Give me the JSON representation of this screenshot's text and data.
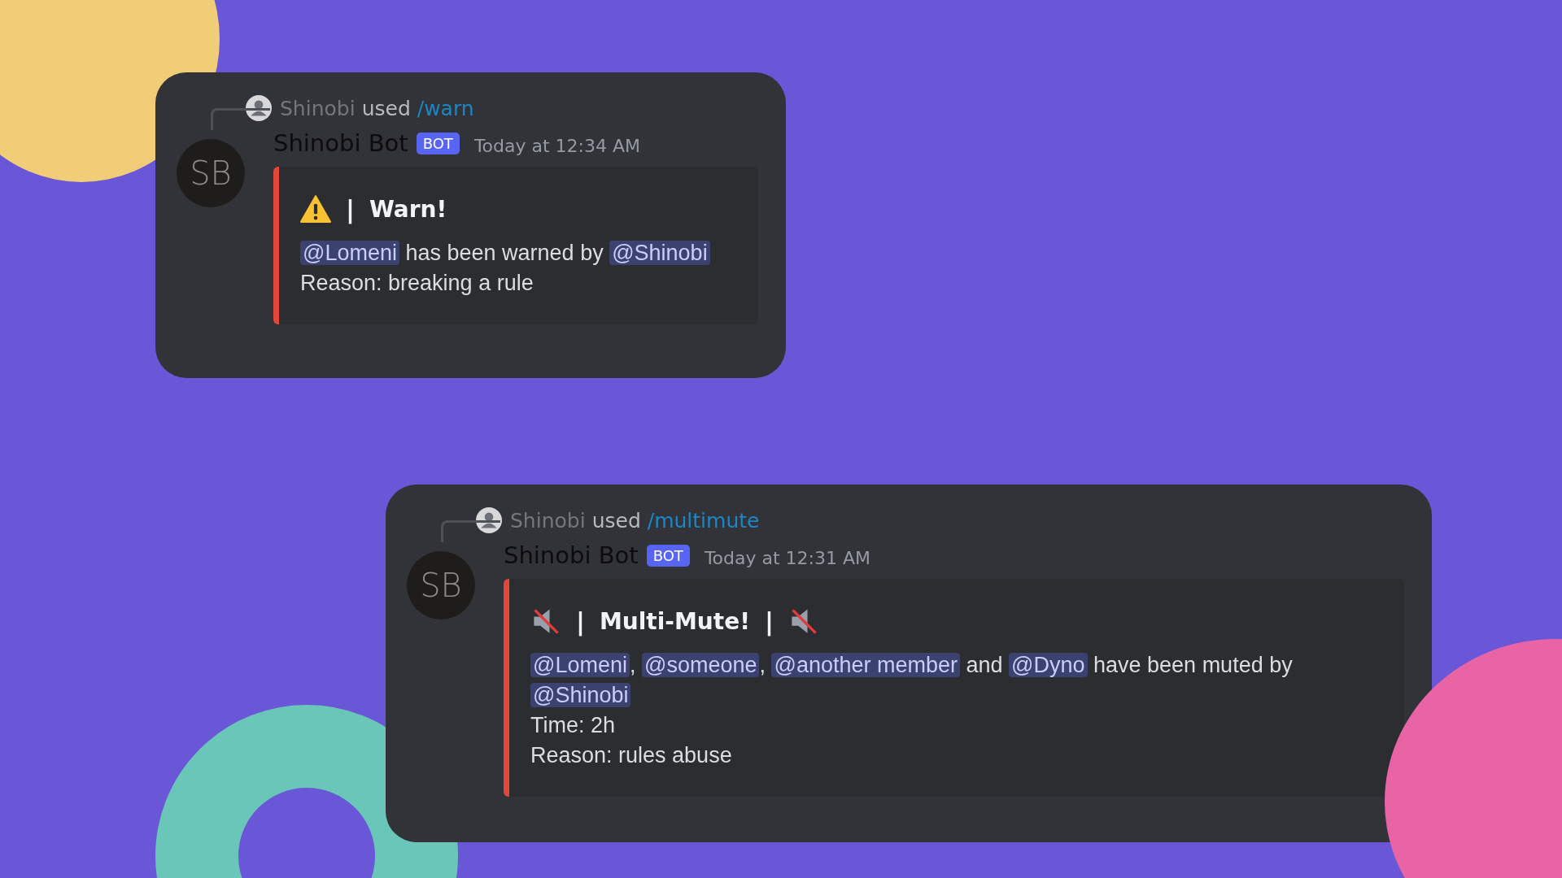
{
  "messages": [
    {
      "reply": {
        "user": "Shinobi",
        "verb": "used",
        "command": "/warn"
      },
      "avatar_text": "SB",
      "author": "Shinobi Bot",
      "badge": "BOT",
      "timestamp": "Today at 12:34 AM",
      "embed": {
        "title_parts": [
          {
            "kind": "warning"
          },
          {
            "kind": "text",
            "text": "|"
          },
          {
            "kind": "text",
            "text": "Warn!"
          }
        ],
        "lines": [
          [
            {
              "kind": "mention",
              "text": "@Lomeni"
            },
            {
              "kind": "text",
              "text": " has been warned by "
            },
            {
              "kind": "mention",
              "text": "@Shinobi"
            }
          ],
          [
            {
              "kind": "text",
              "text": "Reason: breaking a rule"
            }
          ]
        ]
      }
    },
    {
      "reply": {
        "user": "Shinobi",
        "verb": "used",
        "command": "/multimute"
      },
      "avatar_text": "SB",
      "author": "Shinobi Bot",
      "badge": "BOT",
      "timestamp": "Today at 12:31 AM",
      "embed": {
        "title_parts": [
          {
            "kind": "mute"
          },
          {
            "kind": "text",
            "text": "|"
          },
          {
            "kind": "text",
            "text": "Multi-Mute!"
          },
          {
            "kind": "text",
            "text": "|"
          },
          {
            "kind": "mute"
          }
        ],
        "lines": [
          [
            {
              "kind": "mention",
              "text": "@Lomeni"
            },
            {
              "kind": "text",
              "text": ", "
            },
            {
              "kind": "mention",
              "text": "@someone"
            },
            {
              "kind": "text",
              "text": ", "
            },
            {
              "kind": "mention",
              "text": "@another member"
            },
            {
              "kind": "text",
              "text": " and "
            },
            {
              "kind": "mention",
              "text": "@Dyno"
            },
            {
              "kind": "text",
              "text": " have been muted by"
            }
          ],
          [
            {
              "kind": "mention",
              "text": "@Shinobi"
            }
          ],
          [
            {
              "kind": "text",
              "text": "Time: 2h"
            }
          ],
          [
            {
              "kind": "text",
              "text": "Reason: rules abuse"
            }
          ]
        ]
      }
    }
  ]
}
